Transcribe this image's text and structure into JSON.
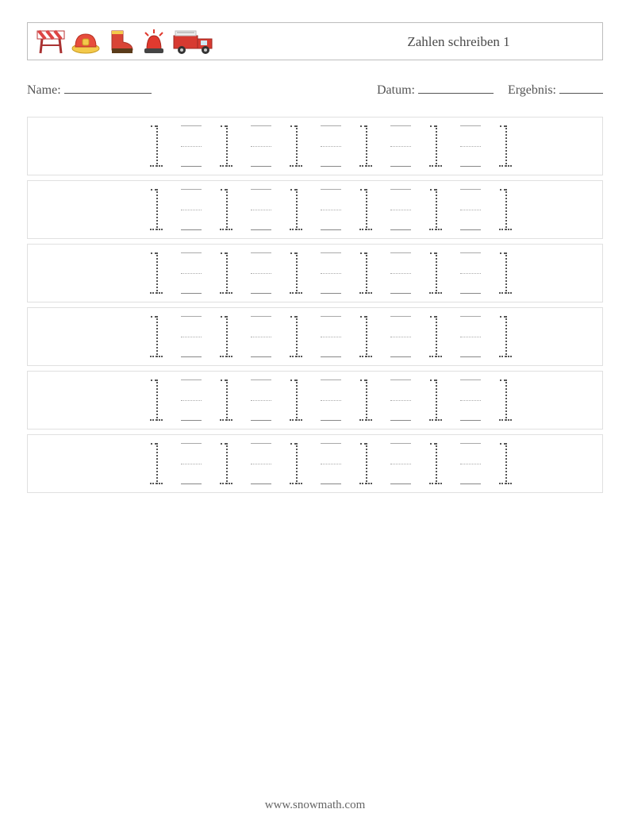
{
  "title": "Zahlen schreiben 1",
  "meta": {
    "name_label": "Name:",
    "date_label": "Datum:",
    "result_label": "Ergebnis:"
  },
  "worksheet": {
    "rows": 6,
    "pattern_per_row": [
      "1",
      "blank",
      "1",
      "blank",
      "1",
      "blank",
      "1",
      "blank",
      "1",
      "blank",
      "1"
    ],
    "traced_numeral": "1"
  },
  "footer": "www.snowmath.com",
  "icons": [
    "barricade",
    "fire-helmet",
    "fire-boot",
    "siren",
    "fire-truck"
  ]
}
